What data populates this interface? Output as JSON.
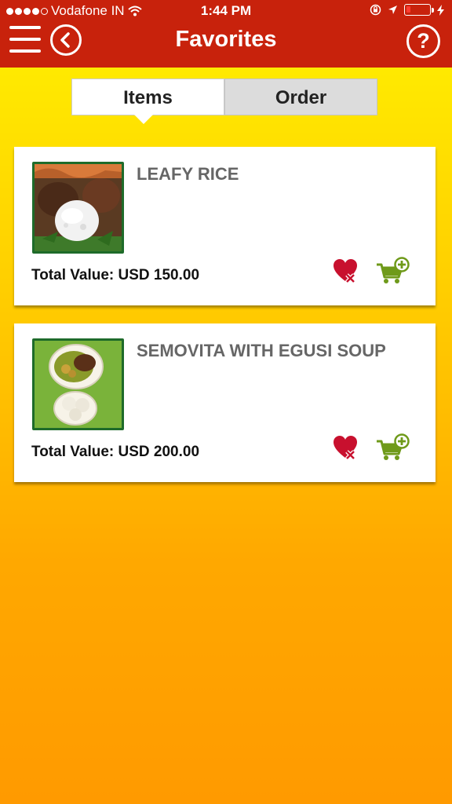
{
  "status": {
    "carrier": "Vodafone IN",
    "time": "1:44 PM",
    "battery_level": 0.1
  },
  "nav": {
    "title": "Favorites",
    "menu_icon": "hamburger-menu-icon",
    "back_icon": "chevron-left-icon",
    "help_label": "?"
  },
  "tabs": [
    {
      "label": "Items",
      "active": true
    },
    {
      "label": "Order",
      "active": false
    }
  ],
  "items": [
    {
      "name": "LEAFY RICE",
      "total": "Total Value: USD 150.00",
      "image": "leafy-rice-photo"
    },
    {
      "name": "SEMOVITA WITH EGUSI SOUP",
      "total": "Total Value: USD 200.00",
      "image": "semovita-egusi-photo"
    }
  ],
  "colors": {
    "header_red": "#c8220c",
    "heart_red": "#c8102e",
    "cart_green": "#6f9a1a"
  }
}
